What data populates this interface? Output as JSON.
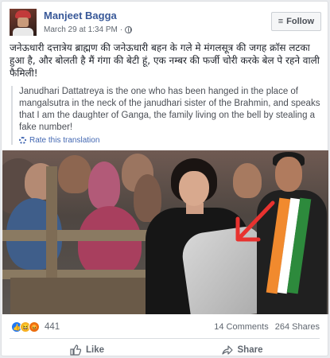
{
  "post": {
    "author": "Manjeet Bagga",
    "date": "March 29 at 1:34 PM",
    "separator": "·",
    "follow_label": "Follow",
    "hindi_text": "जनेऊधारी दत्तात्रेय ब्राह्मण की जनेऊधारी बहन के गले मे मंगलसूत्र की जगह क्रॉस लटका हुआ है, और बोलती है मैं गंगा की बेटी हूं, एक नम्बर की फर्जी चोरी करके बेल पे रहने वाली फैमिली!",
    "translation": "Janudhari Dattatreya is the one who has been hanged in the place of mangalsutra in the neck of the janudhari sister of the Brahmin, and speaks that I am the daughter of Ganga, the family living on the bell by stealing a fake number!",
    "rate_label": "Rate this translation"
  },
  "icons": {
    "follow": "rss-icon",
    "privacy": "globe-icon",
    "rate": "gear-icon",
    "like": "thumbs-up-icon",
    "share": "share-arrow-icon"
  },
  "engagement": {
    "reaction_count": "441",
    "comments": "14 Comments",
    "shares": "264 Shares"
  },
  "actions": {
    "like_label": "Like",
    "share_label": "Share"
  },
  "colors": {
    "link_blue": "#385898",
    "accent_blue": "#4267b2",
    "arrow_red": "#e8322f"
  }
}
